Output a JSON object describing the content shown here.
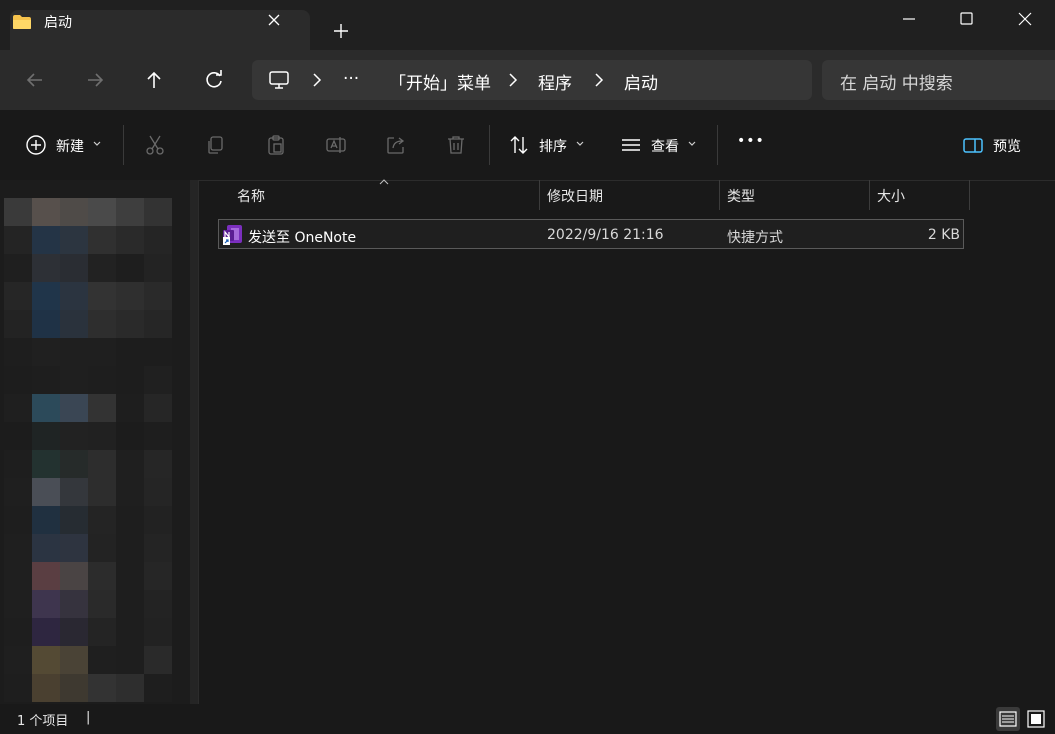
{
  "window": {
    "tab_title": "启动",
    "new_tab_symbol": "+"
  },
  "breadcrumb": {
    "overflow": "···",
    "items": [
      "「开始」菜单",
      "程序",
      "启动"
    ]
  },
  "search": {
    "placeholder": "在 启动 中搜索"
  },
  "toolbar": {
    "new_label": "新建",
    "sort_label": "排序",
    "view_label": "查看",
    "more_label": "•••",
    "preview_label": "预览"
  },
  "columns": {
    "name": "名称",
    "modified": "修改日期",
    "type": "类型",
    "size": "大小"
  },
  "files": [
    {
      "name": "发送至 OneNote",
      "modified": "2022/9/16 21:16",
      "type": "快捷方式",
      "size": "2 KB"
    }
  ],
  "status": {
    "count_text": "1 个项目",
    "divider": "|"
  },
  "colors": {
    "background": "#191919",
    "toolbar_bg": "#2b2b2b",
    "folder_yellow": "#f5c24c",
    "onenote_purple": "#7b2fbe",
    "accent_blue": "#4cc2ff"
  }
}
